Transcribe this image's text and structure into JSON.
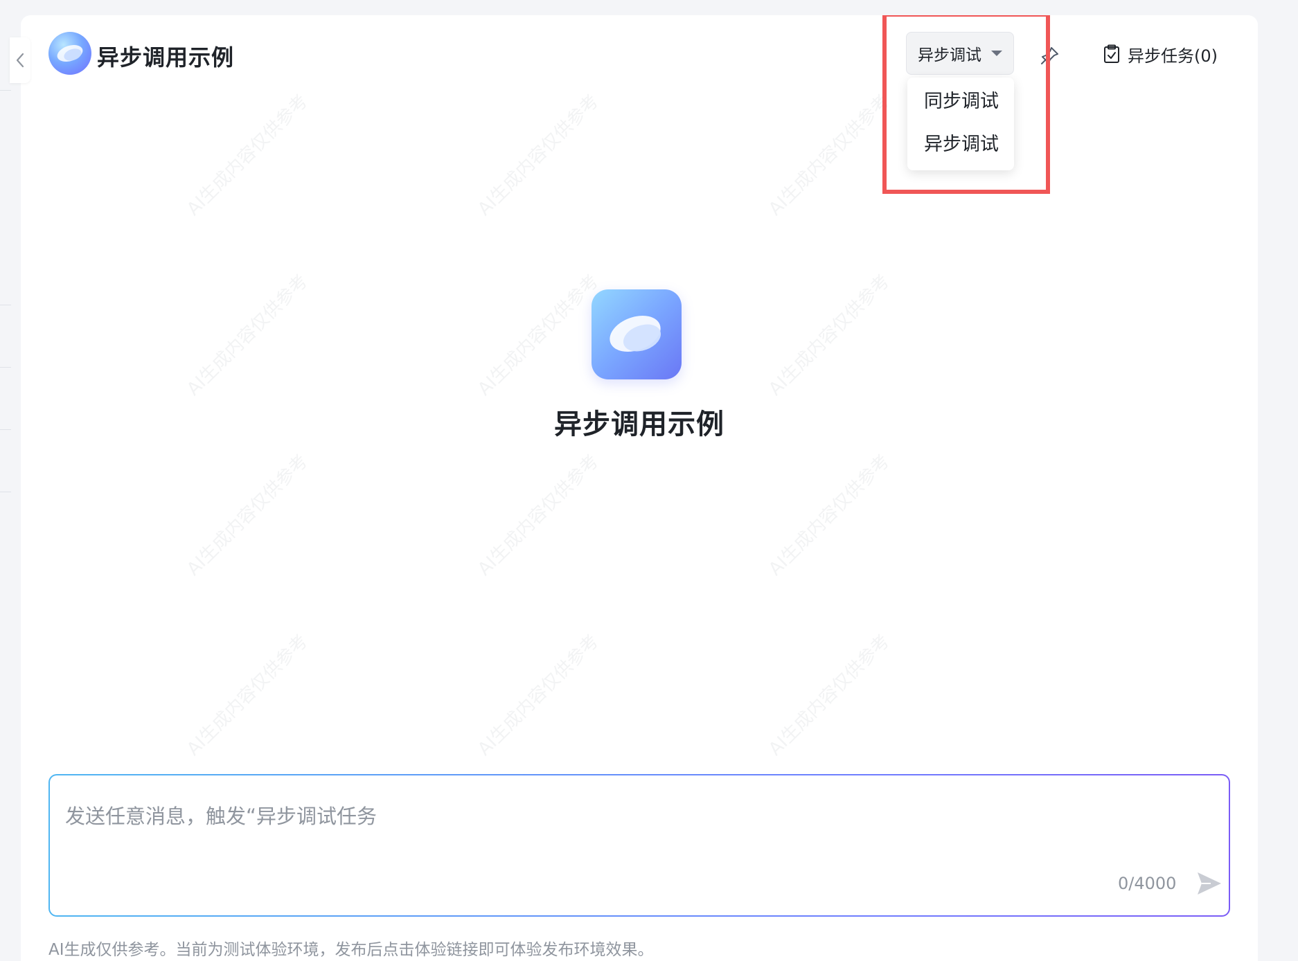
{
  "header": {
    "title": "异步调用示例",
    "mode_select_value": "异步调试",
    "mode_options": [
      "同步调试",
      "异步调试"
    ],
    "tasks_label": "异步任务(0)"
  },
  "hero": {
    "title": "异步调用示例"
  },
  "watermark": "AI生成内容仅供参考",
  "input": {
    "placeholder": "发送任意消息，触发“异步调试任务",
    "counter": "0/4000"
  },
  "footer": {
    "disclaimer": "AI生成仅供参考。当前为测试体验环境，发布后点击体验链接即可体验发布环境效果。"
  },
  "colors": {
    "highlight": "#f05656",
    "accent_start": "#4fb6f2",
    "accent_end": "#7a5cf6"
  },
  "icons": {
    "back": "chevron-left-icon",
    "pin": "pin-icon",
    "tasks": "clipboard-check-icon",
    "send": "send-icon"
  }
}
